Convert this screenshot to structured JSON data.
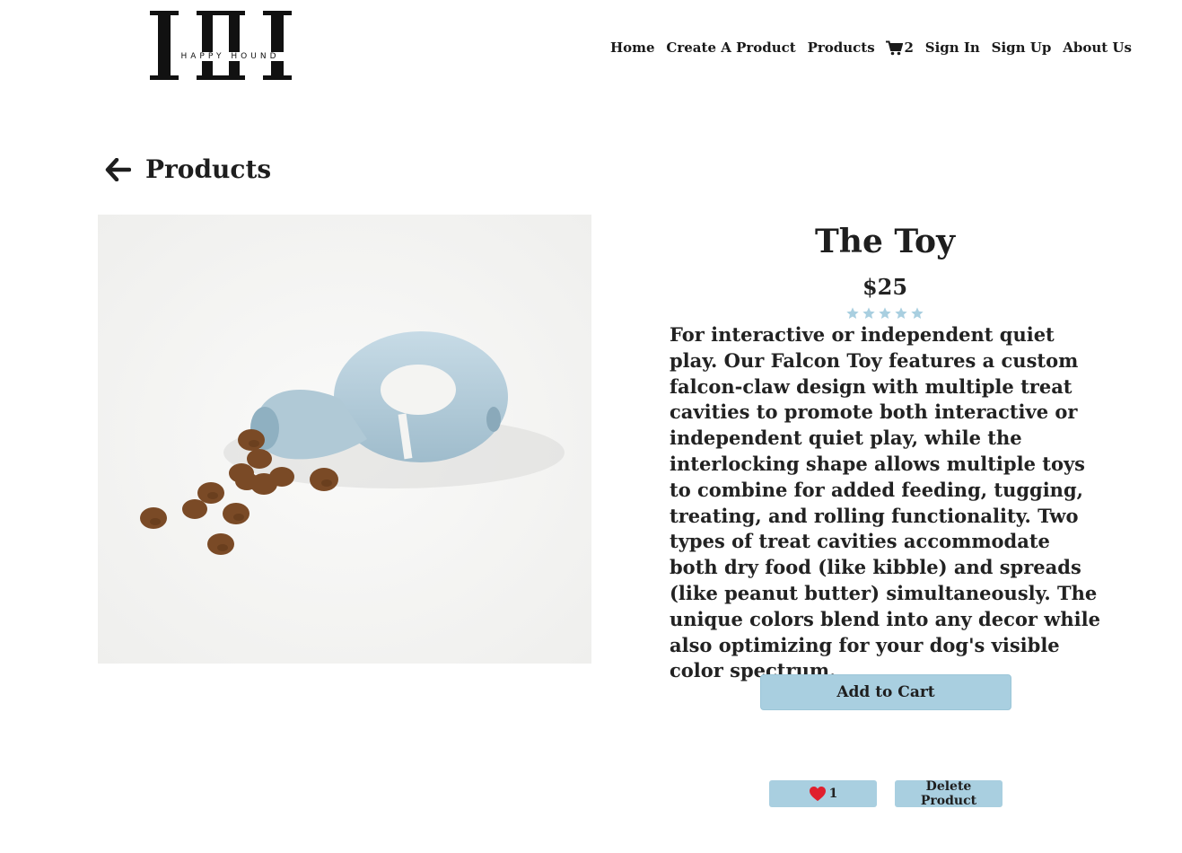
{
  "brand": {
    "logo_text": "HAPPY HOUND"
  },
  "nav": {
    "home": "Home",
    "create": "Create A Product",
    "products": "Products",
    "cart_count": "2",
    "signin": "Sign In",
    "signup": "Sign Up",
    "about": "About Us"
  },
  "back": {
    "label": "Products"
  },
  "product": {
    "title": "The Toy",
    "price": "$25",
    "rating": 5,
    "description": "For interactive or independent quiet play. Our Falcon Toy features a custom falcon-claw design with multiple treat cavities to promote both interactive or independent quiet play, while the interlocking shape allows multiple toys to combine for added feeding, tugging, treating, and rolling functionality. Two types of treat cavities accommodate both dry food (like kibble) and spreads (like peanut butter) simultaneously. The unique colors blend into any decor while also optimizing for your dog's visible color spectrum."
  },
  "actions": {
    "add_to_cart": "Add to Cart",
    "likes": "1",
    "delete": "Delete Product"
  },
  "colors": {
    "accent": "#a9cfe0",
    "star": "#a9cfe0",
    "toy": "#b6cfdc",
    "kibble": "#7a4a26"
  }
}
